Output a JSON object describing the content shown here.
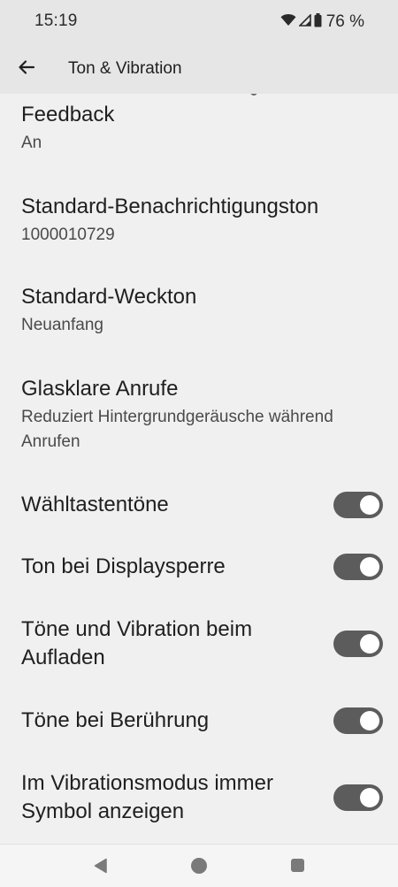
{
  "status_bar": {
    "time": "15:19",
    "battery": "76 %",
    "icons": [
      "wifi-icon",
      "cellular-signal-icon",
      "battery-icon"
    ]
  },
  "app_bar": {
    "back_icon": "back-arrow-icon",
    "title": "Ton & Vibration"
  },
  "settings": [
    {
      "title": "Feedback",
      "subtitle": "An"
    },
    {
      "title": "Standard-Benachrichtigungston",
      "subtitle": "1000010729"
    },
    {
      "title": "Standard-Weckton",
      "subtitle": "Neuanfang"
    },
    {
      "title": "Glasklare Anrufe",
      "subtitle": "Reduziert Hintergrundgeräusche während Anrufen"
    }
  ],
  "toggles": [
    {
      "label": "Wähltastentöne",
      "on": true
    },
    {
      "label": "Ton bei Displaysperre",
      "on": true
    },
    {
      "label": "Töne und Vibration beim Aufladen",
      "on": true
    },
    {
      "label": "Töne bei Berührung",
      "on": true
    },
    {
      "label": "Im Vibrationsmodus immer Symbol anzeigen",
      "on": true
    }
  ],
  "nav_bar": {
    "icons": [
      "nav-back-icon",
      "nav-home-icon",
      "nav-recents-icon"
    ]
  },
  "colors": {
    "background": "#f0f0f0",
    "app_bar": "#e6e6e6",
    "toggle_track_on": "#5c5c5c",
    "toggle_knob": "#ffffff"
  }
}
